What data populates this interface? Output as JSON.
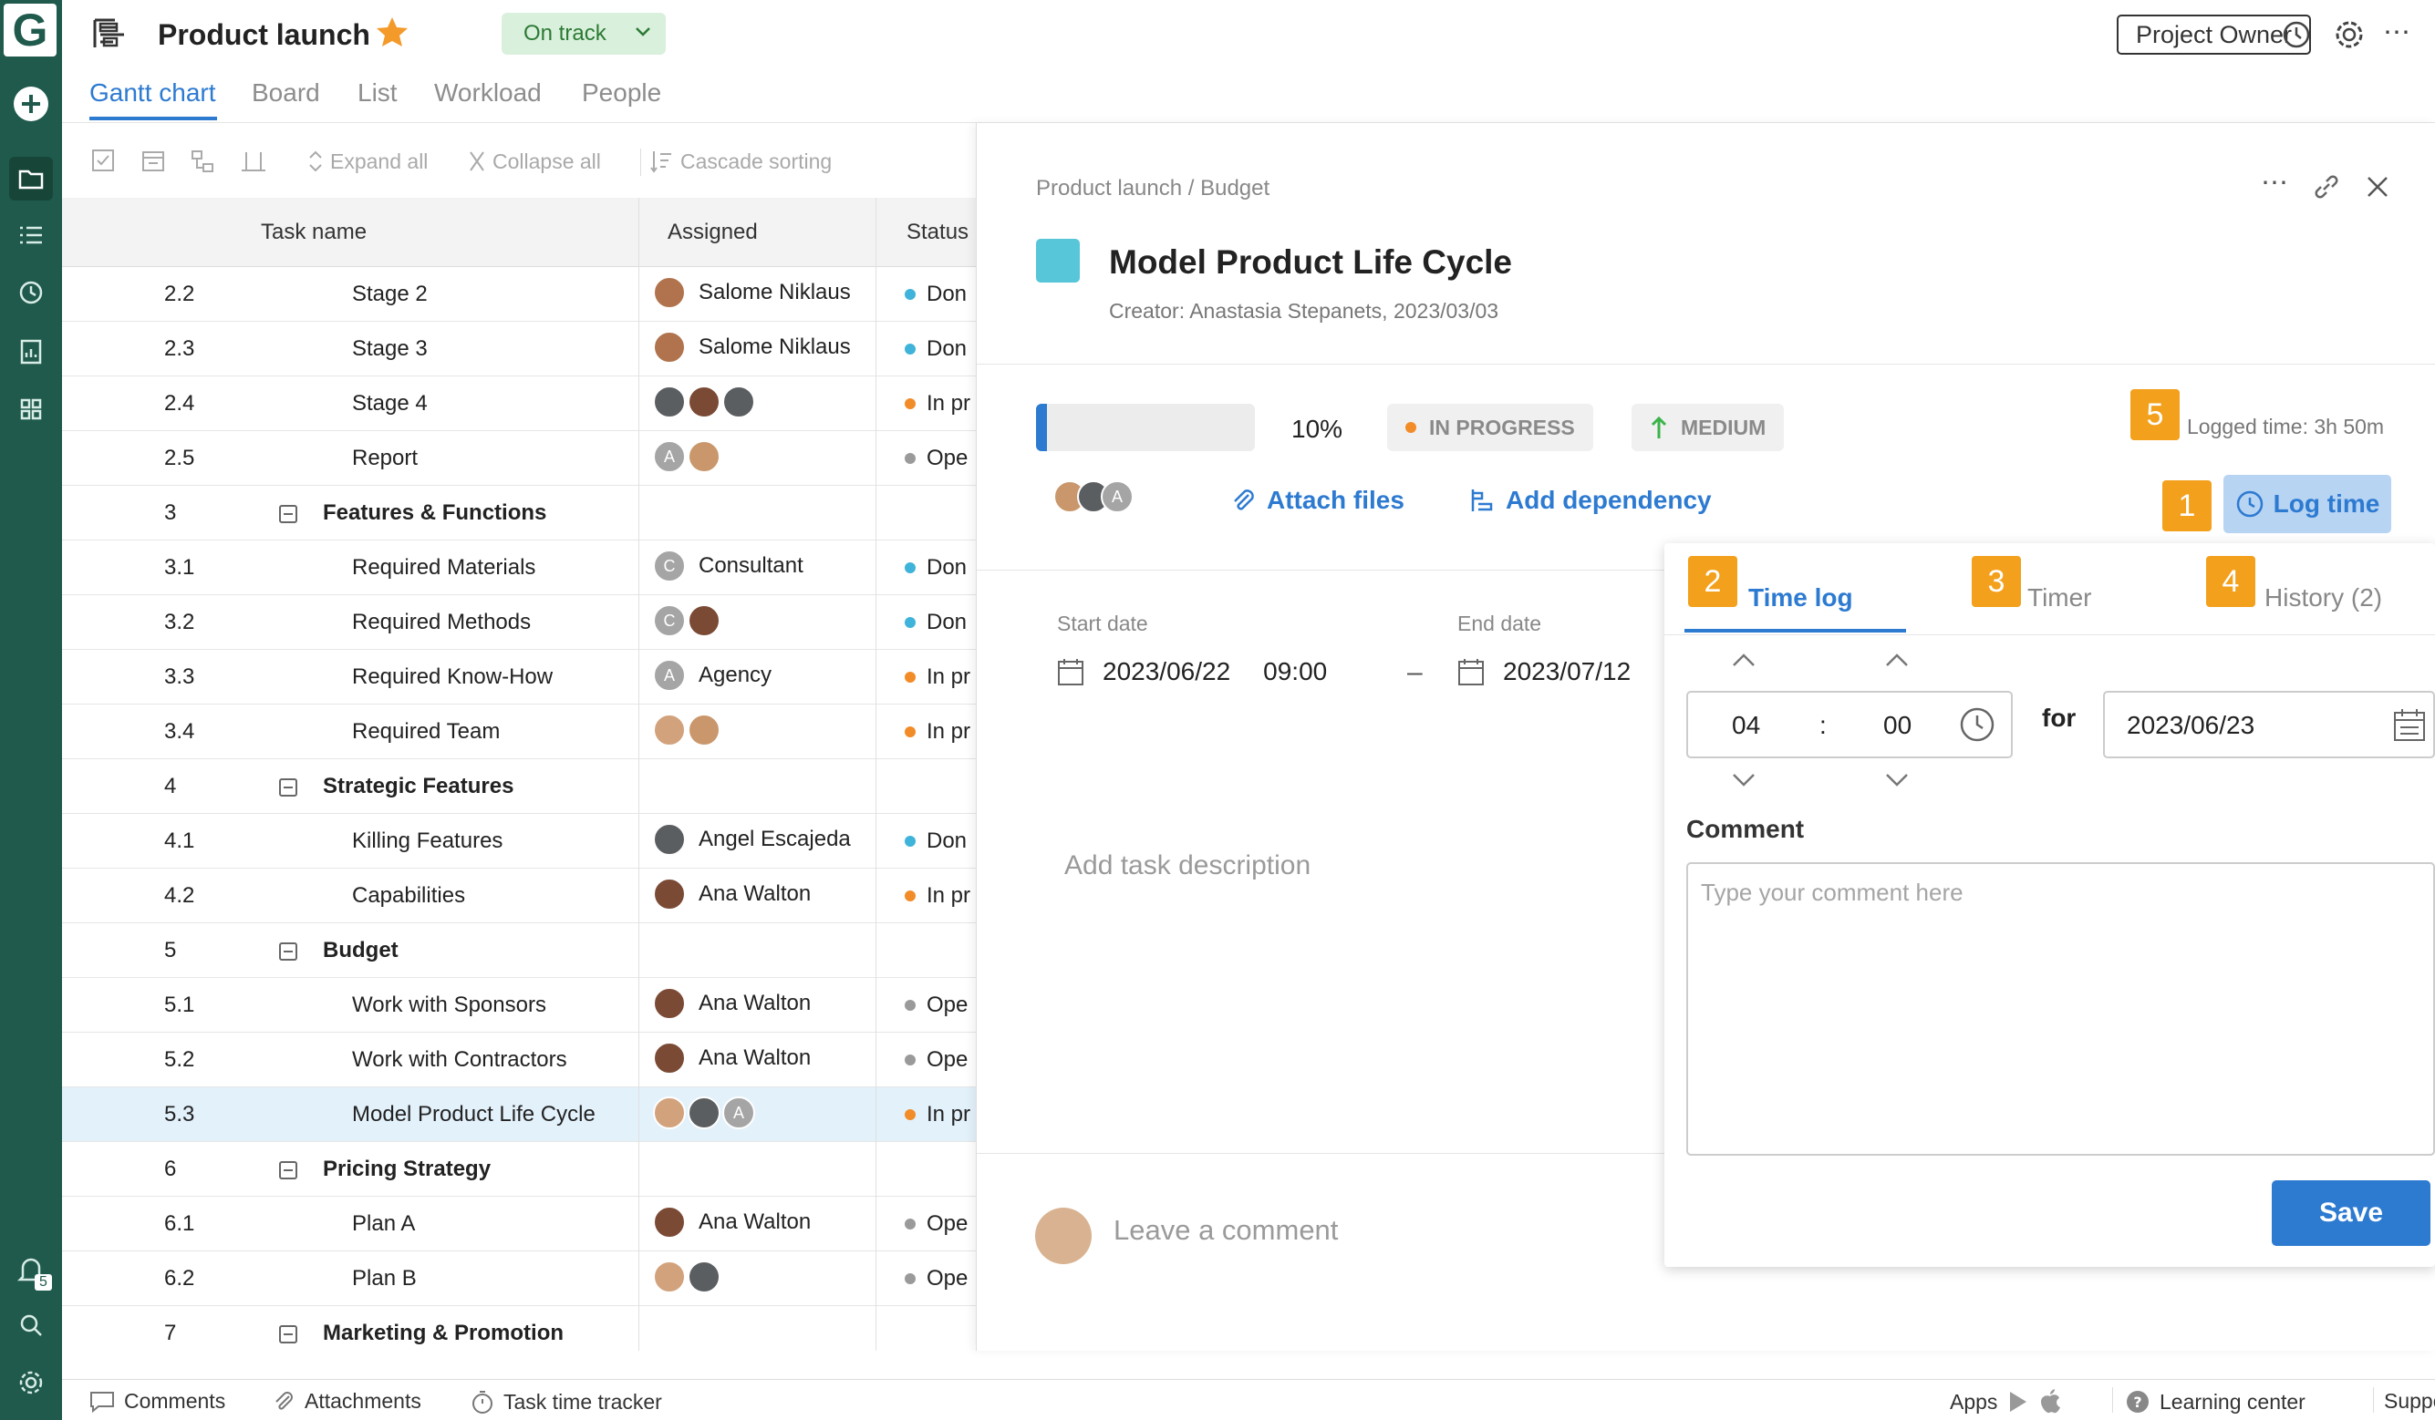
{
  "project": {
    "title": "Product launch",
    "status": "On track",
    "owner_button": "Project Owner"
  },
  "tabs": [
    "Gantt chart",
    "Board",
    "List",
    "Workload",
    "People"
  ],
  "toolbar": {
    "expand_all": "Expand all",
    "collapse_all": "Collapse all",
    "cascade_sorting": "Cascade sorting"
  },
  "grid": {
    "headers": {
      "task_name": "Task name",
      "assigned": "Assigned",
      "status": "Status"
    },
    "rows": [
      {
        "num": "2.2",
        "name": "Stage 2",
        "level": 2,
        "assigned": "Salome Niklaus",
        "status": "Don",
        "status_color": "#3fb3d9"
      },
      {
        "num": "2.3",
        "name": "Stage 3",
        "level": 2,
        "assigned": "Salome Niklaus",
        "status": "Don",
        "status_color": "#3fb3d9"
      },
      {
        "num": "2.4",
        "name": "Stage 4",
        "level": 2,
        "assigned": "",
        "status": "In pr",
        "status_color": "#f28c28"
      },
      {
        "num": "2.5",
        "name": "Report",
        "level": 2,
        "assigned": "",
        "status": "Ope",
        "status_color": "#9a9a9a"
      },
      {
        "num": "3",
        "name": "Features & Functions",
        "level": 1,
        "assigned": "",
        "status": "",
        "status_color": ""
      },
      {
        "num": "3.1",
        "name": "Required Materials",
        "level": 2,
        "assigned": "Consultant",
        "status": "Don",
        "status_color": "#3fb3d9"
      },
      {
        "num": "3.2",
        "name": "Required Methods",
        "level": 2,
        "assigned": "",
        "status": "Don",
        "status_color": "#3fb3d9"
      },
      {
        "num": "3.3",
        "name": "Required Know-How",
        "level": 2,
        "assigned": "Agency",
        "status": "In pr",
        "status_color": "#f28c28"
      },
      {
        "num": "3.4",
        "name": "Required Team",
        "level": 2,
        "assigned": "",
        "status": "In pr",
        "status_color": "#f28c28"
      },
      {
        "num": "4",
        "name": "Strategic Features",
        "level": 1,
        "assigned": "",
        "status": "",
        "status_color": ""
      },
      {
        "num": "4.1",
        "name": "Killing Features",
        "level": 2,
        "assigned": "Angel Escajeda",
        "status": "Don",
        "status_color": "#3fb3d9"
      },
      {
        "num": "4.2",
        "name": "Capabilities",
        "level": 2,
        "assigned": "Ana Walton",
        "status": "In pr",
        "status_color": "#f28c28"
      },
      {
        "num": "5",
        "name": "Budget",
        "level": 1,
        "assigned": "",
        "status": "",
        "status_color": ""
      },
      {
        "num": "5.1",
        "name": "Work with Sponsors",
        "level": 2,
        "assigned": "Ana Walton",
        "status": "Ope",
        "status_color": "#9a9a9a"
      },
      {
        "num": "5.2",
        "name": "Work with Contractors",
        "level": 2,
        "assigned": "Ana Walton",
        "status": "Ope",
        "status_color": "#9a9a9a"
      },
      {
        "num": "5.3",
        "name": "Model Product Life Cycle",
        "level": 2,
        "assigned": "",
        "status": "In pr",
        "status_color": "#f28c28"
      },
      {
        "num": "6",
        "name": "Pricing Strategy",
        "level": 1,
        "assigned": "",
        "status": "",
        "status_color": ""
      },
      {
        "num": "6.1",
        "name": "Plan A",
        "level": 2,
        "assigned": "Ana Walton",
        "status": "Ope",
        "status_color": "#9a9a9a"
      },
      {
        "num": "6.2",
        "name": "Plan B",
        "level": 2,
        "assigned": "",
        "status": "Ope",
        "status_color": "#9a9a9a"
      },
      {
        "num": "7",
        "name": "Marketing & Promotion",
        "level": 1,
        "assigned": "",
        "status": "",
        "status_color": ""
      }
    ]
  },
  "avatar_letters": {
    "a": "A",
    "c": "C"
  },
  "panel": {
    "breadcrumb": "Product launch / Budget",
    "title": "Model Product Life Cycle",
    "creator": "Creator: Anastasia Stepanets, 2023/03/03",
    "progress_label": "10%",
    "progress_value": 0.1,
    "status_chip": "IN PROGRESS",
    "priority_chip": "MEDIUM",
    "logged_time": "Logged time: 3h 50m",
    "attach_files": "Attach files",
    "add_dependency": "Add dependency",
    "log_time_button": "Log time",
    "start_date_label": "Start date",
    "start_date": "2023/06/22",
    "start_time": "09:00",
    "date_separator": "–",
    "end_date_label": "End date",
    "end_date": "2023/07/12",
    "description_placeholder": "Add task description",
    "comment_placeholder": "Leave a comment"
  },
  "badges": {
    "one": "1",
    "two": "2",
    "three": "3",
    "four": "4",
    "five": "5"
  },
  "time_log": {
    "tabs": {
      "time_log": "Time log",
      "timer": "Timer",
      "history": "History (2)"
    },
    "hours": "04",
    "separator": ":",
    "minutes": "00",
    "for_label": "for",
    "date": "2023/06/23",
    "comment_label": "Comment",
    "comment_placeholder": "Type your comment here",
    "save": "Save"
  },
  "footer": {
    "comments": "Comments",
    "attachments": "Attachments",
    "tracker": "Task time tracker",
    "apps": "Apps",
    "learning": "Learning center",
    "support": "Support"
  },
  "notifications_count": "5",
  "colors": {
    "rail": "#1f5a4c",
    "accent": "#2d7ad1",
    "badge": "#f3a01c",
    "star": "#f39a2b"
  }
}
